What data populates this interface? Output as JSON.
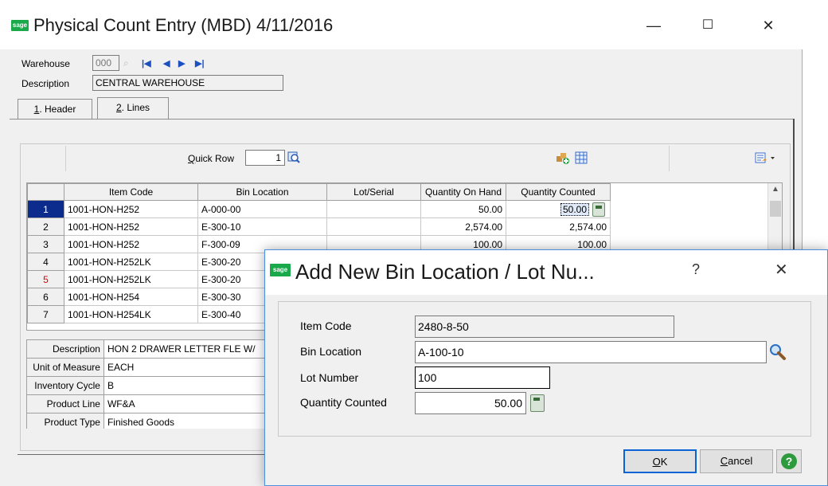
{
  "window": {
    "logo": "sage",
    "title": "Physical Count Entry (MBD) 4/11/2016",
    "controls": {
      "minimize": "—",
      "maximize": "☐",
      "close": "✕"
    }
  },
  "header": {
    "warehouse_label": "Warehouse",
    "warehouse_value": "000",
    "description_label": "Description",
    "description_value": "CENTRAL WAREHOUSE"
  },
  "tabs": [
    {
      "num": "1",
      "rest": ". Header"
    },
    {
      "num": "2",
      "rest": ". Lines"
    }
  ],
  "toolbar": {
    "quick_row_label": "Quick Row",
    "quick_row_value": "1"
  },
  "grid": {
    "columns": [
      "",
      "Item Code",
      "Bin Location",
      "Lot/Serial",
      "Quantity On Hand",
      "Quantity Counted"
    ],
    "rows": [
      {
        "n": "1",
        "item": "1001-HON-H252",
        "bin": "A-000-00",
        "lot": "",
        "onhand": "50.00",
        "counted": "50.00"
      },
      {
        "n": "2",
        "item": "1001-HON-H252",
        "bin": "E-300-10",
        "lot": "",
        "onhand": "2,574.00",
        "counted": "2,574.00"
      },
      {
        "n": "3",
        "item": "1001-HON-H252",
        "bin": "F-300-09",
        "lot": "",
        "onhand": "100.00",
        "counted": "100.00"
      },
      {
        "n": "4",
        "item": "1001-HON-H252LK",
        "bin": "E-300-20",
        "lot": "",
        "onhand": "",
        "counted": ""
      },
      {
        "n": "5",
        "item": "1001-HON-H252LK",
        "bin": "E-300-20",
        "lot": "",
        "onhand": "",
        "counted": ""
      },
      {
        "n": "6",
        "item": "1001-HON-H254",
        "bin": "E-300-30",
        "lot": "",
        "onhand": "",
        "counted": ""
      },
      {
        "n": "7",
        "item": "1001-HON-H254LK",
        "bin": "E-300-40",
        "lot": "",
        "onhand": "",
        "counted": ""
      }
    ]
  },
  "detail": [
    {
      "label": "Description",
      "value": "HON 2 DRAWER LETTER FLE W/"
    },
    {
      "label": "Unit of Measure",
      "value": "EACH"
    },
    {
      "label": "Inventory Cycle",
      "value": "B"
    },
    {
      "label": "Product Line",
      "value": "WF&A"
    },
    {
      "label": "Product Type",
      "value": "Finished Goods"
    }
  ],
  "dialog": {
    "logo": "sage",
    "title": "Add New Bin Location / Lot Nu...",
    "help": "?",
    "close": "✕",
    "fields": {
      "item_code_label": "Item Code",
      "item_code_value": "2480-8-50",
      "bin_location_label": "Bin Location",
      "bin_location_value": "A-100-10",
      "lot_number_label": "Lot Number",
      "lot_number_value": "100",
      "qty_counted_label": "Quantity Counted",
      "qty_counted_value": "50.00"
    },
    "buttons": {
      "ok_underlined": "O",
      "ok_rest": "K",
      "cancel_underlined": "C",
      "cancel_rest": "ancel",
      "help_glyph": "?"
    }
  },
  "colors": {
    "sage_green": "#19a84a",
    "selected_row": "#0b2c8c",
    "dialog_border": "#4a90e2",
    "default_button_border": "#0a64d6"
  }
}
